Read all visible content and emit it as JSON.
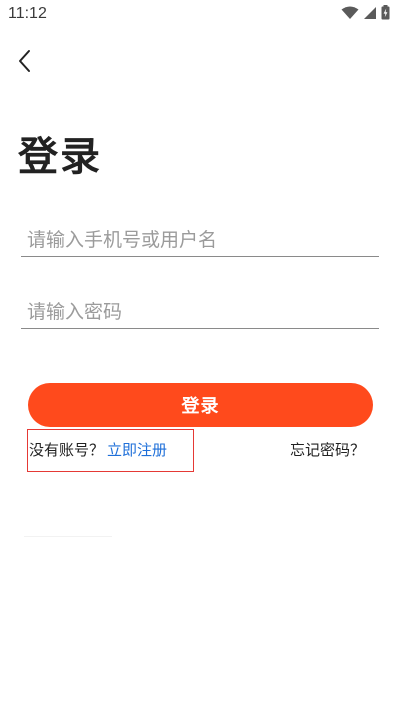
{
  "status_bar": {
    "time": "11:12",
    "icons": [
      "wifi-icon",
      "cellular-signal-icon",
      "battery-charging-icon"
    ]
  },
  "header": {
    "back_icon": "chevron-left-icon"
  },
  "page": {
    "title": "登录"
  },
  "form": {
    "username_placeholder": "请输入手机号或用户名",
    "username_value": "",
    "password_placeholder": "请输入密码",
    "password_value": "",
    "login_label": "登录"
  },
  "links": {
    "no_account_text": "没有账号？",
    "register_label": "立即注册",
    "forgot_label": "忘记密码？"
  },
  "colors": {
    "accent": "#ff4a1c",
    "link": "#1e6fd9",
    "highlight": "#e53935"
  }
}
